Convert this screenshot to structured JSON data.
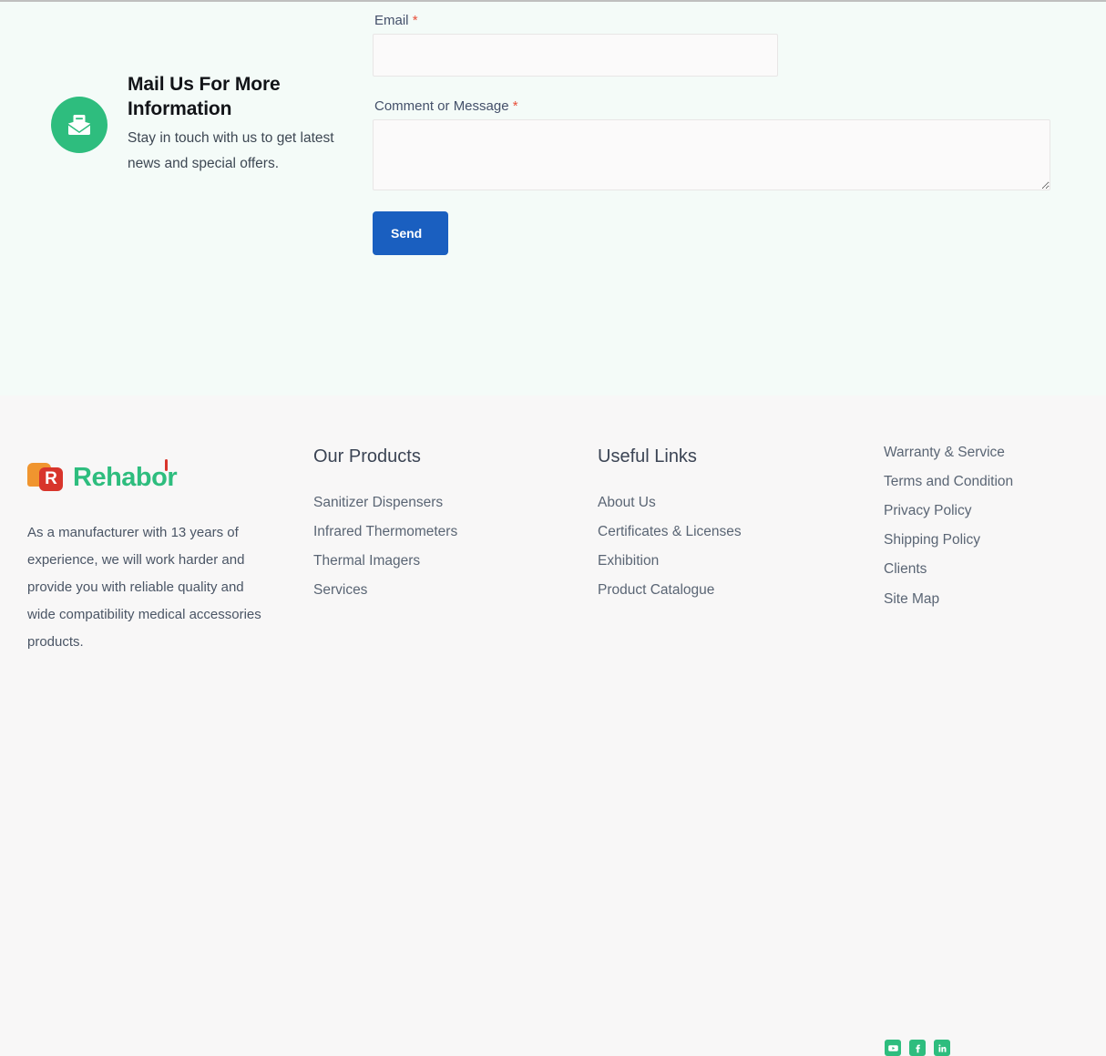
{
  "contact": {
    "icon": "open-envelope-mail-icon",
    "heading": "Mail Us For More Information",
    "subtitle": "Stay in touch with us to get latest news and special offers.",
    "accent_color": "#2ebd7e"
  },
  "form": {
    "email": {
      "label": "Email",
      "required_marker": "*",
      "value": "",
      "placeholder": ""
    },
    "message": {
      "label": "Comment or Message",
      "required_marker": "*",
      "value": "",
      "placeholder": ""
    },
    "submit_label": "Send",
    "submit_color": "#1a5fc0",
    "required_color": "#e8503a"
  },
  "footer": {
    "brand": {
      "logo_letter": "R",
      "logo_word": "Rehabor",
      "logo_word_color": "#2ebd7e",
      "logo_mark_colors": [
        "#f0952f",
        "#d8342b"
      ],
      "description": "As a manufacturer with 13 years of experience, we will work harder and provide you with reliable quality and wide compatibility medical accessories products."
    },
    "columns": [
      {
        "heading": "Our Products",
        "links": [
          "Sanitizer Dispensers",
          "Infrared Thermometers",
          "Thermal Imagers",
          "Services"
        ]
      },
      {
        "heading": "Useful Links",
        "links": [
          "About Us",
          "Certificates & Licenses",
          "Exhibition",
          "Product Catalogue"
        ]
      },
      {
        "heading": "",
        "links": [
          "Warranty & Service",
          "Terms and Condition",
          "Privacy Policy",
          "Shipping Policy",
          "Clients",
          "Site Map"
        ]
      }
    ],
    "social": [
      {
        "name": "youtube-icon",
        "label": "YouTube"
      },
      {
        "name": "facebook-icon",
        "label": "Facebook"
      },
      {
        "name": "linkedin-icon",
        "label": "LinkedIn"
      }
    ],
    "social_color": "#2ebd7e"
  }
}
